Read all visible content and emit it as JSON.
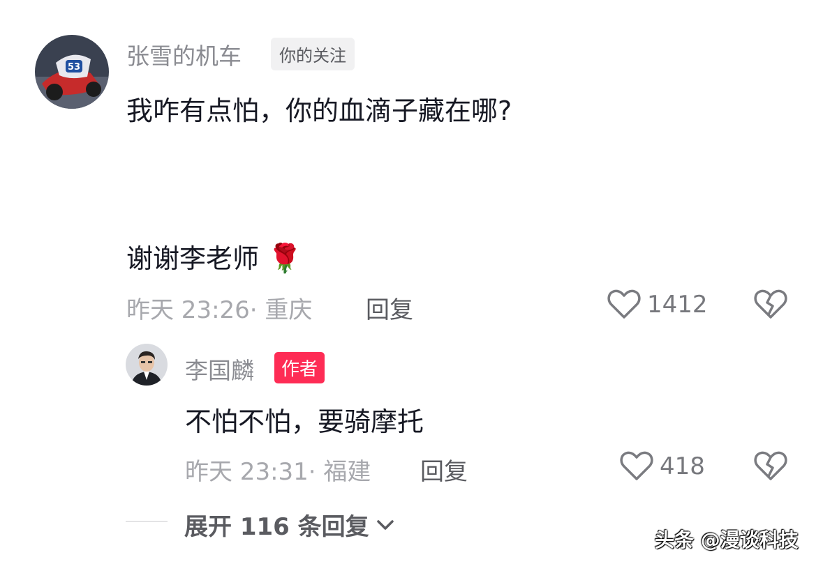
{
  "comment": {
    "username": "张雪的机车",
    "follow_badge": "你的关注",
    "text_line1": "我咋有点怕，你的血滴子藏在哪?",
    "text_line2": "谢谢李老师",
    "emoji": "🌹",
    "meta": "昨天 23:26· 重庆",
    "reply_label": "回复",
    "like_count": "1412",
    "avatar_number": "53"
  },
  "reply": {
    "username": "李国麟",
    "author_badge": "作者",
    "text": "不怕不怕，要骑摩托",
    "meta": "昨天 23:31· 福建",
    "reply_label": "回复",
    "like_count": "418"
  },
  "expand": {
    "label": "展开 116 条回复"
  },
  "watermark": "头条 @漫谈科技",
  "icons": {
    "like": "heart-outline-icon",
    "dislike": "broken-heart-icon",
    "expand": "chevron-down-icon"
  }
}
